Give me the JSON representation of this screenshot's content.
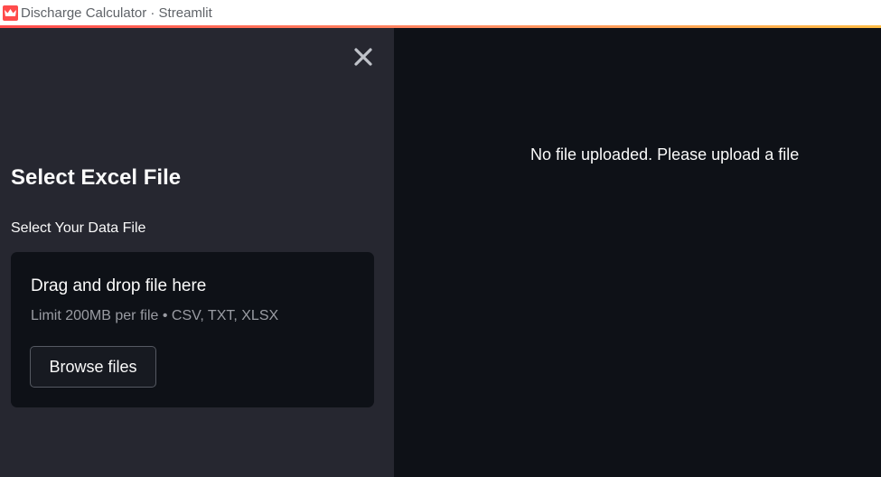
{
  "window": {
    "title": "Discharge Calculator · Streamlit",
    "favicon_icon": "streamlit-crown-icon"
  },
  "colors": {
    "accent": "#ff4b4b",
    "sidebar_bg": "#262730",
    "main_bg": "#0e1117",
    "text": "#fafafa"
  },
  "sidebar": {
    "close_icon": "close-icon",
    "title": "Select Excel File",
    "uploader": {
      "label": "Select Your Data File",
      "dropzone_title": "Drag and drop file here",
      "limit_text": "Limit 200MB per file • CSV, TXT, XLSX",
      "browse_label": "Browse files"
    }
  },
  "main": {
    "message": "No file uploaded. Please upload a file"
  }
}
